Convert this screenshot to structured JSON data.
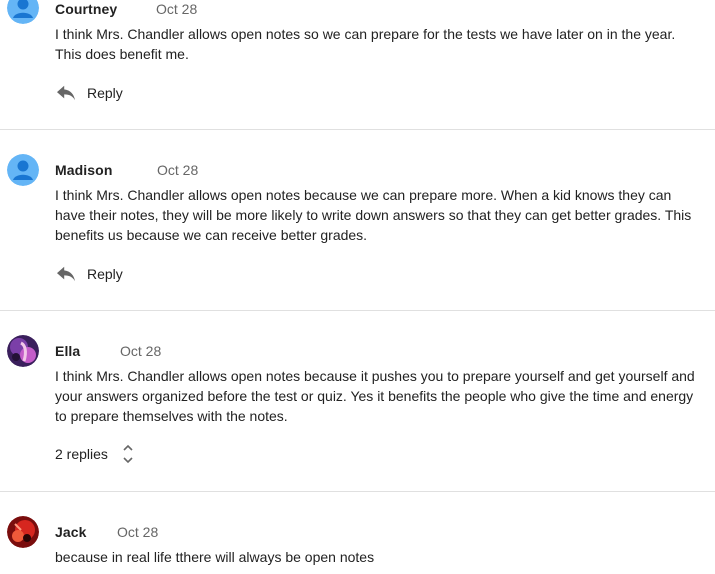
{
  "comments": [
    {
      "name": "Courtney",
      "date": "Oct 28",
      "text": "I think Mrs. Chandler allows open notes so we can prepare for the tests we have later on in the year. This does benefit me.",
      "action": "Reply",
      "avatar": "default-person-icon"
    },
    {
      "name": "Madison",
      "date": "Oct 28",
      "text": "I think Mrs. Chandler allows open notes because we can prepare more. When a kid knows they can have their notes, they will be more likely to write down answers so that they can get better grades. This benefits us because we can receive better grades.",
      "action": "Reply",
      "avatar": "default-person-icon"
    },
    {
      "name": "Ella",
      "date": "Oct 28",
      "text": "I think Mrs. Chandler allows open notes because it pushes you to prepare yourself and get yourself and your answers organized before the test or quiz. Yes it benefits the people who give the time and energy to prepare themselves with the notes.",
      "replies_label": "2 replies",
      "avatar": "photo-avatar-purple"
    },
    {
      "name": "Jack",
      "date": "Oct 28",
      "text": "because in real life tthere will always be open notes",
      "avatar": "photo-avatar-red"
    }
  ],
  "colors": {
    "default_avatar_bg": "#64b5f6",
    "default_avatar_fg": "#1976d2",
    "divider": "#e0e0e0",
    "date": "#666666",
    "reply_icon": "#666666"
  }
}
